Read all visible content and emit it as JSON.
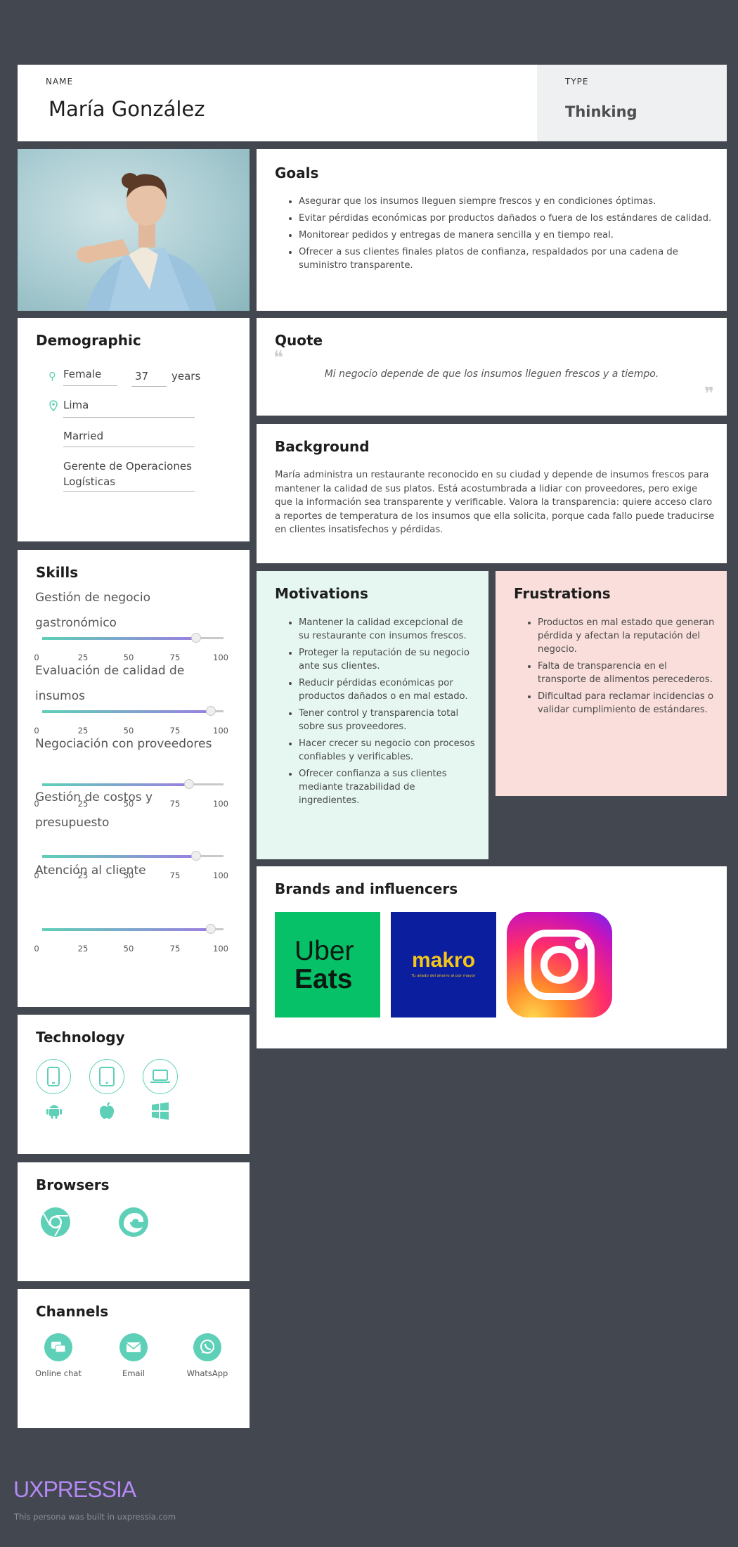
{
  "header": {
    "name_label": "NAME",
    "name": "María González",
    "type_label": "TYPE",
    "type": "Thinking"
  },
  "goals": {
    "title": "Goals",
    "items": [
      "Asegurar que los insumos lleguen siempre frescos y en condiciones óptimas.",
      "Evitar pérdidas económicas por productos dañados o fuera de los estándares de calidad.",
      "Monitorear pedidos y entregas de manera sencilla y en tiempo real.",
      "Ofrecer a sus clientes finales platos de confianza, respaldados por una cadena de suministro transparente."
    ]
  },
  "demographic": {
    "title": "Demographic",
    "gender": "Female",
    "age": "37",
    "age_unit": "years",
    "location": "Lima",
    "status": "Married",
    "occupation": "Gerente de Operaciones Logísticas"
  },
  "quote": {
    "title": "Quote",
    "text": "Mi negocio depende de que los insumos lleguen frescos y a tiempo."
  },
  "background": {
    "title": "Background",
    "text": "María administra un restaurante reconocido en su ciudad y depende de insumos frescos para mantener la calidad de sus platos. Está acostumbrada a lidiar con proveedores, pero exige que la información sea transparente y verificable. Valora la transparencia: quiere acceso claro a reportes de temperatura de los insumos que ella solicita, porque cada fallo puede traducirse en clientes insatisfechos y pérdidas."
  },
  "skills": {
    "title": "Skills",
    "tick_labels": [
      "0",
      "25",
      "50",
      "75",
      "100"
    ],
    "items": [
      {
        "label": "Gestión de negocio gastronómico",
        "value": 85
      },
      {
        "label": "Evaluación de calidad de insumos",
        "value": 93
      },
      {
        "label": "Negociación con proveedores",
        "value": 81
      },
      {
        "label": "Gestión de costos y presupuesto",
        "value": 85
      },
      {
        "label": "Atención al cliente",
        "value": 93
      }
    ]
  },
  "motivations": {
    "title": "Motivations",
    "items": [
      "Mantener la calidad excepcional de su restaurante con insumos frescos.",
      "Proteger la reputación de su negocio ante sus clientes.",
      "Reducir pérdidas económicas por productos dañados o en mal estado.",
      "Tener control y transparencia total sobre sus proveedores.",
      "Hacer crecer su negocio con procesos confiables y verificables.",
      "Ofrecer confianza a sus clientes mediante trazabilidad de ingredientes."
    ]
  },
  "frustrations": {
    "title": "Frustrations",
    "items": [
      "Productos en mal estado que generan pérdida y afectan la reputación del negocio.",
      "Falta de transparencia en el transporte de alimentos perecederos.",
      "Dificultad para reclamar incidencias o validar cumplimiento de estándares."
    ]
  },
  "brands": {
    "title": "Brands and influencers",
    "uber_line1": "Uber",
    "uber_line2": "Eats",
    "makro_name": "makro",
    "makro_tagline": "Tu aliado del ahorro al por mayor",
    "instagram_icon": "instagram-icon"
  },
  "technology": {
    "title": "Technology",
    "icons": [
      "phone-icon",
      "tablet-icon",
      "laptop-icon",
      "android-icon",
      "apple-icon",
      "windows-icon"
    ]
  },
  "browsers": {
    "title": "Browsers",
    "icons": [
      "chrome-icon",
      "edge-icon"
    ]
  },
  "channels": {
    "title": "Channels",
    "items": [
      "Online chat",
      "Email",
      "WhatsApp"
    ]
  },
  "footer": {
    "brand": "UXPRESSIA",
    "note": "This persona was built in uxpressia.com"
  },
  "colors": {
    "background": "#434750",
    "accent": "#5ed0b7",
    "purple": "#9b7fe0",
    "motivations_bg": "#e6f7f2",
    "frustrations_bg": "#f9dedb"
  }
}
